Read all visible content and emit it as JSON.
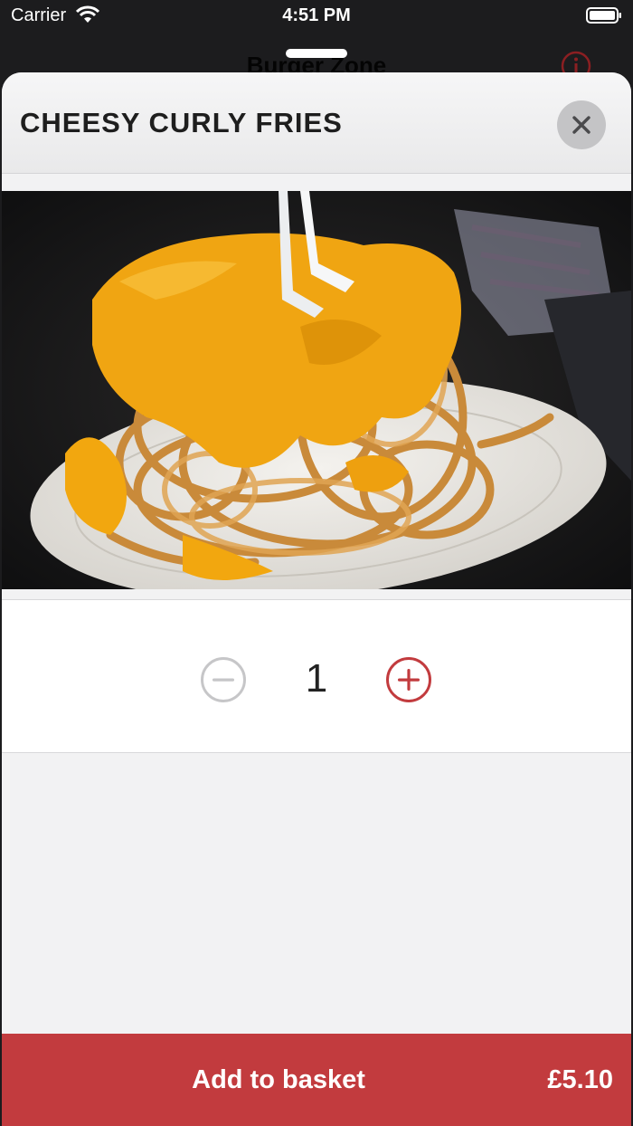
{
  "status_bar": {
    "carrier": "Carrier",
    "time": "4:51 PM"
  },
  "background_nav": {
    "title": "Burger Zone"
  },
  "item": {
    "title": "CHEESY CURLY FRIES",
    "photo_icon": "food-photo"
  },
  "quantity": {
    "value": "1"
  },
  "add_bar": {
    "label": "Add to basket",
    "price": "£5.10"
  },
  "colors": {
    "accent": "#c23b3e",
    "sheet_bg": "#f2f2f3",
    "disabled": "#c6c6c8"
  }
}
